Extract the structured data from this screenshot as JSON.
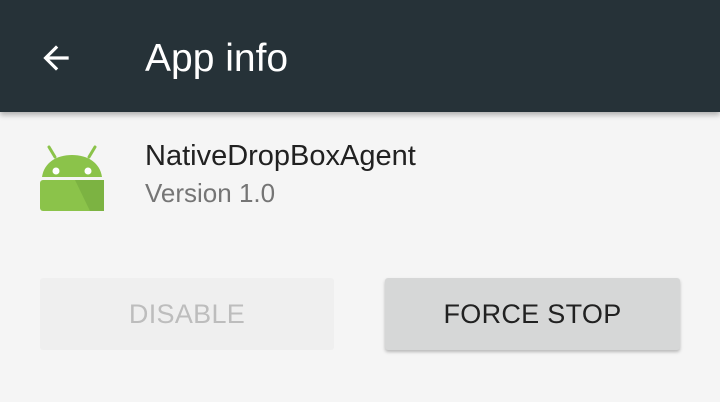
{
  "app_bar": {
    "title": "App info",
    "back_icon": "arrow-back-icon",
    "background_color": "#263238"
  },
  "app": {
    "name": "NativeDropBoxAgent",
    "version": "Version 1.0",
    "icon": "android-robot-icon",
    "icon_color": "#8bc34a"
  },
  "actions": {
    "disable_label": "DISABLE",
    "disable_enabled": false,
    "force_stop_label": "FORCE STOP",
    "force_stop_enabled": true
  }
}
